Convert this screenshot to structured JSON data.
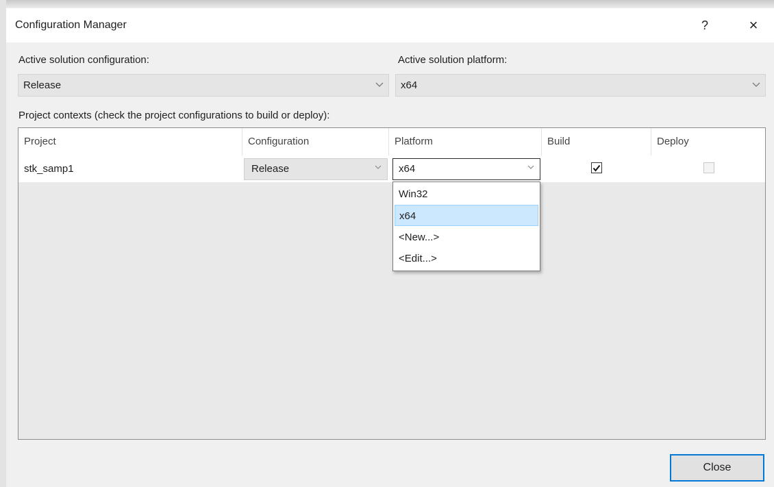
{
  "window": {
    "title": "Configuration Manager",
    "help_glyph": "?",
    "close_glyph": "×"
  },
  "solution": {
    "config_label": "Active solution configuration:",
    "config_value": "Release",
    "platform_label": "Active solution platform:",
    "platform_value": "x64"
  },
  "contexts_label": "Project contexts (check the project configurations to build or deploy):",
  "grid": {
    "columns": [
      "Project",
      "Configuration",
      "Platform",
      "Build",
      "Deploy"
    ],
    "rows": [
      {
        "project": "stk_samp1",
        "configuration": "Release",
        "platform": "x64",
        "build": true,
        "deploy": false
      }
    ]
  },
  "platform_dropdown": {
    "items": [
      "Win32",
      "x64",
      "<New...>",
      "<Edit...>"
    ],
    "selected": "x64"
  },
  "buttons": {
    "close_label": "Close"
  },
  "icons": {
    "chevron": "chevron-down-icon",
    "check": "checkmark-icon"
  },
  "colors": {
    "accent": "#0078d7",
    "selection": "#cce8ff"
  }
}
